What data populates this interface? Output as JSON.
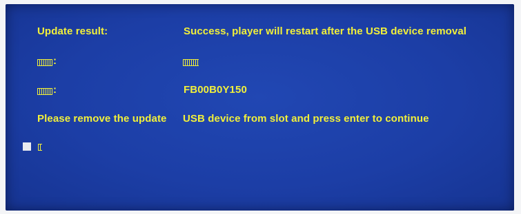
{
  "update_result": {
    "label": "Update result:",
    "value": "Success, player will restart after the USB device removal"
  },
  "row2": {
    "label_colon": ":"
  },
  "row3": {
    "label_colon": ":",
    "value": "FB00B0Y150"
  },
  "instruction": {
    "part1": "Please remove the update",
    "part2": "USB device from slot and press enter to continue"
  },
  "colors": {
    "background": "#1c3ea6",
    "text": "#f2f03a"
  }
}
